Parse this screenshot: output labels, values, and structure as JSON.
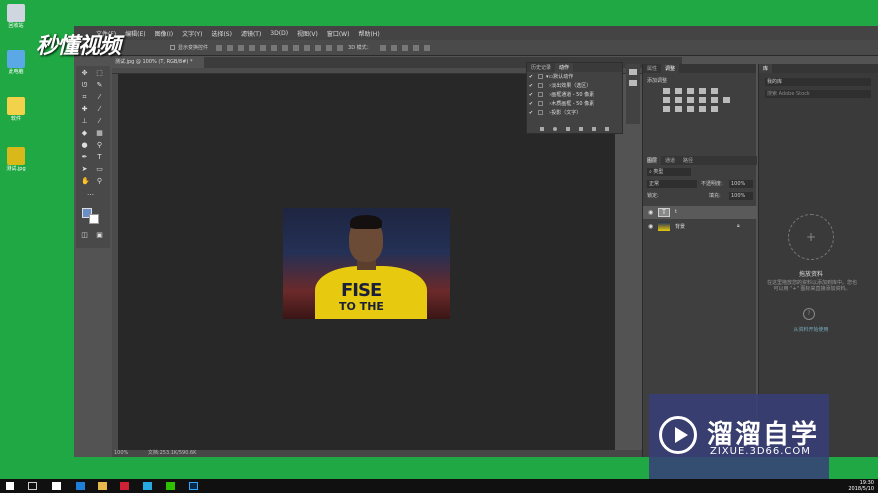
{
  "desktop": {
    "icons": [
      {
        "label": "回收站",
        "color": "#cfd6e0"
      },
      {
        "label": "此电脑",
        "color": "#5aa9e6"
      },
      {
        "label": "软件",
        "color": "#f2d24b"
      },
      {
        "label": "测试.jpg",
        "color": "#d9b91a"
      }
    ]
  },
  "watermark": {
    "brand_top": "秒懂视频",
    "brand_box_title": "溜溜自学",
    "brand_box_sub": "ZIXUE.3D66.COM"
  },
  "ps": {
    "menu": [
      "文件(F)",
      "编辑(E)",
      "图像(I)",
      "文字(Y)",
      "选择(S)",
      "滤镜(T)",
      "3D(D)",
      "视图(V)",
      "窗口(W)",
      "帮助(H)"
    ],
    "options": {
      "show_transform": "显示变换控件",
      "mode_3d": "3D 模式："
    },
    "doc_tab": "测试.jpg @ 100% (T, RGB/8#) *",
    "status": {
      "zoom": "100%",
      "doc": "文档:253.1K/590.6K"
    },
    "actions_panel": {
      "tabs": [
        "历史记录",
        "动作"
      ],
      "rows": [
        "默认动作",
        "淡出效果（选区）",
        "画框通道 - 50 像素",
        "木质画框 - 50 像素",
        "投影（文字）"
      ]
    },
    "properties_tabs": [
      "属性",
      "调整"
    ],
    "adjust_hint": "添加调整",
    "layers_tabs": [
      "图层",
      "通道",
      "路径"
    ],
    "layers": {
      "filter": "类型",
      "blend": "正常",
      "opacity_label": "不透明度:",
      "opacity": "100%",
      "lock_label": "锁定:",
      "fill_label": "填充:",
      "fill": "100%",
      "items": [
        {
          "name": "t",
          "kind": "text"
        },
        {
          "name": "背景",
          "kind": "image"
        }
      ]
    },
    "libraries": {
      "tab": "库",
      "dropdown": "我的库",
      "search_placeholder": "搜索 Adobe Stock",
      "title": "拖放资料",
      "desc": "在这里拖放您的资料以添加到库中。您也可以用 \"+\" 图标来直接添加资料。",
      "link": "从资料开始使用"
    },
    "photo": {
      "shirt_text_1": "FISE",
      "shirt_text_2": "TO THE"
    }
  },
  "taskbar": {
    "time": "19:30",
    "date": "2018/5/10"
  }
}
